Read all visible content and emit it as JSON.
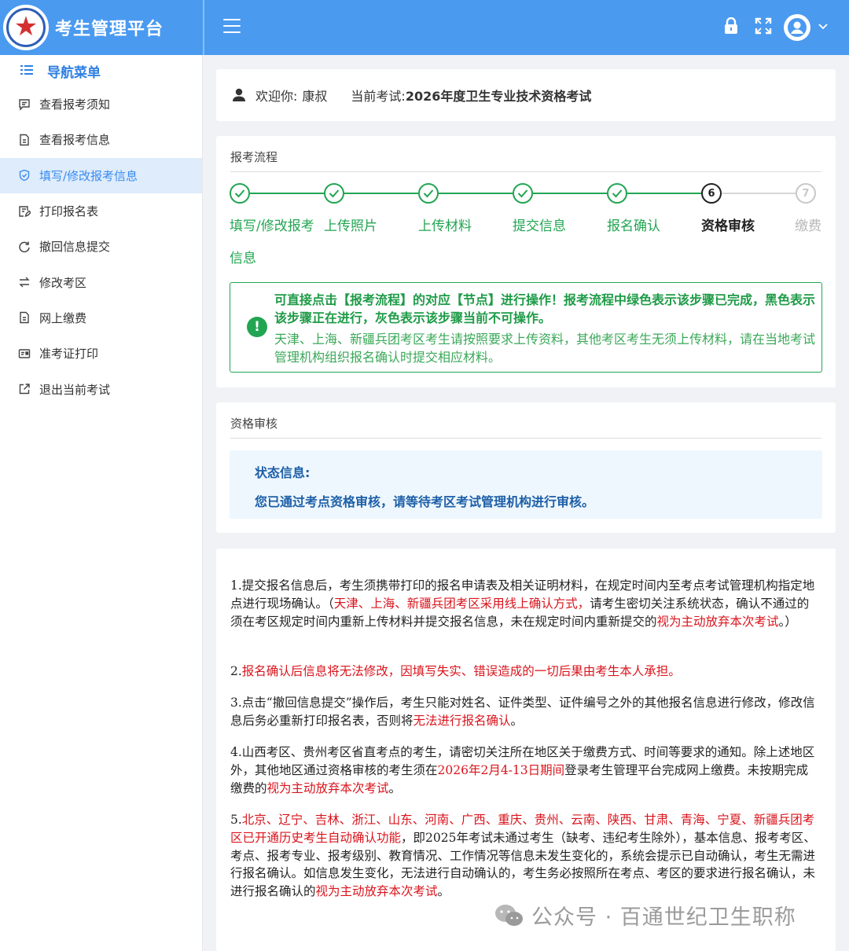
{
  "app": {
    "title": "考生管理平台"
  },
  "sidebar": {
    "heading": "导航菜单",
    "items": [
      {
        "label": "查看报考须知",
        "icon": "message-square-icon"
      },
      {
        "label": "查看报考信息",
        "icon": "document-icon"
      },
      {
        "label": "填写/修改报考信息",
        "icon": "check-shield-icon",
        "active": true
      },
      {
        "label": "打印报名表",
        "icon": "edit-document-icon"
      },
      {
        "label": "撤回信息提交",
        "icon": "refresh-icon"
      },
      {
        "label": "修改考区",
        "icon": "swap-icon"
      },
      {
        "label": "网上缴费",
        "icon": "document-icon"
      },
      {
        "label": "准考证打印",
        "icon": "id-card-icon"
      },
      {
        "label": "退出当前考试",
        "icon": "external-link-icon"
      }
    ]
  },
  "welcome": {
    "greeting_label": "欢迎你:",
    "user_name": "康叔",
    "exam_label": "当前考试:",
    "exam_name": "2026年度卫生专业技术资格考试"
  },
  "flow": {
    "title": "报考流程",
    "steps": [
      {
        "label": "填写/修改报考",
        "label2": "信息",
        "state": "done",
        "num": "1"
      },
      {
        "label": "上传照片",
        "state": "done",
        "num": "2"
      },
      {
        "label": "上传材料",
        "state": "done",
        "num": "3"
      },
      {
        "label": "提交信息",
        "state": "done",
        "num": "4"
      },
      {
        "label": "报名确认",
        "state": "done",
        "num": "5"
      },
      {
        "label": "资格审核",
        "state": "current",
        "num": "6"
      },
      {
        "label": "缴费",
        "state": "todo",
        "num": "7"
      }
    ],
    "alert_bold": "可直接点击【报考流程】的对应【节点】进行操作！报考流程中绿色表示该步骤已完成，黑色表示该步骤正在进行，灰色表示该步骤当前不可操作。",
    "alert_text": "天津、上海、新疆兵团考区考生请按照要求上传资料，其他考区考生无须上传材料，请在当地考试管理机构组织报名确认时提交相应材料。"
  },
  "review": {
    "title": "资格审核",
    "status_heading": "状态信息:",
    "status_message": "您已通过考点资格审核，请等待考区考试管理机构进行审核。"
  },
  "notice": {
    "p1": {
      "a": "1.提交报名信息后，考生须携带打印的报名申请表及相关证明材料，在规定时间内至考点考试管理机构指定地点进行现场确认。（",
      "b": "天津、上海、新疆兵团考区采用线上确认方式，",
      "c": "请考生密切关注系统状态，确认不通过的须在考区规定时间内重新上传材料并提交报名信息，未在规定时间内重新提交的",
      "d": "视为主动放弃本次考试",
      "e": "。）"
    },
    "p2": {
      "a": "2.",
      "b": "报名确认后信息将无法修改，因填写失实、错误造成的一切后果由考生本人承担。"
    },
    "p3": {
      "a": "3.点击“撤回信息提交”操作后，考生只能对姓名、证件类型、证件编号之外的其他报名信息进行修改，修改信息后务必重新打印报名表，否则将",
      "b": "无法进行报名确认",
      "c": "。"
    },
    "p4": {
      "a": "4.山西考区、贵州考区省直考点的考生，请密切关注所在地区关于缴费方式、时间等要求的通知。除上述地区外，其他地区通过资格审核的考生须在",
      "b": "2026年2月4-13日期间",
      "c": "登录考生管理平台完成网上缴费。未按期完成缴费的",
      "d": "视为主动放弃本次考试",
      "e": "。"
    },
    "p5": {
      "a": "5.",
      "b": "北京、辽宁、吉林、浙江、山东、河南、广西、重庆、贵州、云南、陕西、甘肃、青海、宁夏、新疆兵团考区已开通历史考生自动确认功能",
      "c": "，即2025年考试未通过考生（缺考、违纪考生除外），基本信息、报考考区、考点、报考专业、报考级别、教育情况、工作情况等信息未发生变化的，系统会提示已自动确认，考生无需进行报名确认。如信息发生变化，无法进行自动确认的，考生务必按照所在考点、考区的要求进行报名确认，未进行报名确认的",
      "d": "视为主动放弃本次考",
      "e": "试",
      "f": "。"
    }
  },
  "watermark": "公众号 · 百通世纪卫生职称",
  "colors": {
    "topbar": "#4a9af0",
    "done": "#22a552",
    "current": "#222222",
    "todo": "#c8c8c8",
    "red": "#d9141c",
    "status": "#1d5fa8"
  }
}
